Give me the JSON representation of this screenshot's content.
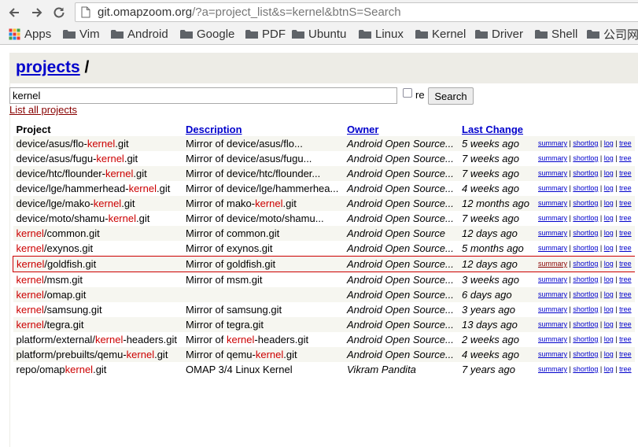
{
  "browser": {
    "url_host": "git.omapzoom.org",
    "url_path": "/?a=project_list&s=kernel&btnS=Search",
    "bookmarks": [
      "Apps",
      "Vim",
      "Android",
      "Google",
      "PDF",
      "Ubuntu",
      "Linux",
      "Kernel",
      "Driver",
      "Shell",
      "公司网"
    ],
    "colors": {
      "apps_icon": [
        "#e53935",
        "#fbc02d",
        "#43a047",
        "#1e88e5"
      ],
      "folder": "#5f6368"
    }
  },
  "page": {
    "title_link": "projects",
    "title_suffix": " /",
    "search": {
      "value": "kernel",
      "re_label": "re",
      "button": "Search"
    },
    "list_all": "List all projects",
    "columns": [
      "Project",
      "Description",
      "Owner",
      "Last Change"
    ],
    "link_labels": [
      "summary",
      "shortlog",
      "log",
      "tree"
    ],
    "rows": [
      {
        "project": [
          "device/asus/flo-",
          "kernel",
          ".git"
        ],
        "desc": [
          "Mirror of device/asus/flo",
          "..."
        ],
        "owner": "Android Open Source...",
        "age": "5 weeks ago"
      },
      {
        "project": [
          "device/asus/fugu-",
          "kernel",
          ".git"
        ],
        "desc": [
          "Mirror of device/asus/fugu",
          "..."
        ],
        "owner": "Android Open Source...",
        "age": "7 weeks ago"
      },
      {
        "project": [
          "device/htc/flounder-",
          "kernel",
          ".git"
        ],
        "desc": [
          "Mirror of device/htc/flounder",
          "..."
        ],
        "owner": "Android Open Source...",
        "age": "7 weeks ago"
      },
      {
        "project": [
          "device/lge/hammerhead-",
          "kernel",
          ".git"
        ],
        "desc": [
          "Mirror of device/lge/hammerhea",
          "..."
        ],
        "owner": "Android Open Source...",
        "age": "4 weeks ago"
      },
      {
        "project": [
          "device/lge/mako-",
          "kernel",
          ".git"
        ],
        "desc": [
          "Mirror of mako-",
          "kernel",
          ".git"
        ],
        "owner": "Android Open Source...",
        "age": "12 months ago"
      },
      {
        "project": [
          "device/moto/shamu-",
          "kernel",
          ".git"
        ],
        "desc": [
          "Mirror of device/moto/shamu",
          "..."
        ],
        "owner": "Android Open Source...",
        "age": "7 weeks ago"
      },
      {
        "project": [
          "",
          "kernel",
          "/common.git"
        ],
        "desc": [
          "Mirror of common.git"
        ],
        "owner": "Android Open Source",
        "age": "12 days ago"
      },
      {
        "project": [
          "",
          "kernel",
          "/exynos.git"
        ],
        "desc": [
          "Mirror of exynos.git"
        ],
        "owner": "Android Open Source...",
        "age": "5 months ago"
      },
      {
        "project": [
          "",
          "kernel",
          "/goldfish.git"
        ],
        "desc": [
          "Mirror of goldfish.git"
        ],
        "owner": "Android Open Source...",
        "age": "12 days ago"
      },
      {
        "project": [
          "",
          "kernel",
          "/msm.git"
        ],
        "desc": [
          "Mirror of msm.git"
        ],
        "owner": "Android Open Source...",
        "age": "3 weeks ago"
      },
      {
        "project": [
          "",
          "kernel",
          "/omap.git"
        ],
        "desc": [
          ""
        ],
        "owner": "Android Open Source...",
        "age": "6 days ago"
      },
      {
        "project": [
          "",
          "kernel",
          "/samsung.git"
        ],
        "desc": [
          "Mirror of samsung.git"
        ],
        "owner": "Android Open Source...",
        "age": "3 years ago"
      },
      {
        "project": [
          "",
          "kernel",
          "/tegra.git"
        ],
        "desc": [
          "Mirror of tegra.git"
        ],
        "owner": "Android Open Source...",
        "age": "13 days ago"
      },
      {
        "project": [
          "platform/external/",
          "kernel",
          "-headers.git"
        ],
        "desc": [
          "Mirror of ",
          "kernel",
          "-headers.git"
        ],
        "owner": "Android Open Source...",
        "age": "2 weeks ago"
      },
      {
        "project": [
          "platform/prebuilts/qemu-",
          "kernel",
          ".git"
        ],
        "desc": [
          "Mirror of qemu-",
          "kernel",
          ".git"
        ],
        "owner": "Android Open Source...",
        "age": "4 weeks ago"
      },
      {
        "project": [
          "repo/omap",
          "kernel",
          ".git"
        ],
        "desc": [
          "OMAP 3/4 Linux Kernel"
        ],
        "owner": "Vikram Pandita",
        "age": "7 years ago"
      }
    ]
  }
}
